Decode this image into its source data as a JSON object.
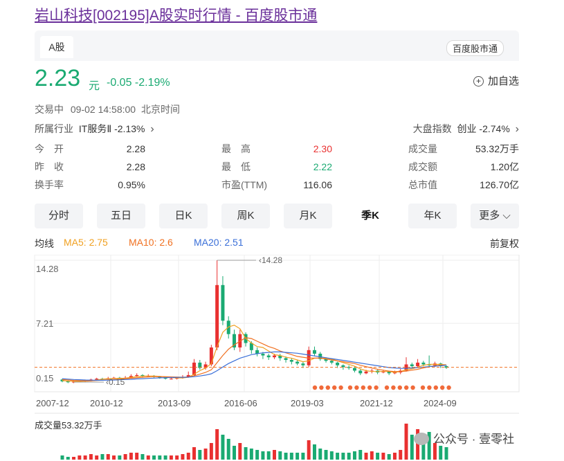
{
  "page_title": "岩山科技[002195]A股实时行情 - 百度股市通",
  "tab_label": "A股",
  "brand_badge": "百度股市通",
  "price": "2.23",
  "price_unit": "元",
  "change": "-0.05",
  "change_pct": "-2.19%",
  "add_watchlist": "加自选",
  "status_text": "交易中",
  "status_time": "09-02 14:58:00",
  "status_tz": "北京时间",
  "industry_label": "所属行业",
  "industry_value": "IT服务Ⅱ -2.13%",
  "market_label": "大盘指数",
  "market_value": "创业 -2.74%",
  "chevron": "›",
  "stats": [
    {
      "label": "今　开",
      "value": "2.28",
      "color": "#333333"
    },
    {
      "label": "最　高",
      "value": "2.30",
      "color": "#e93030"
    },
    {
      "label": "成交量",
      "value": "53.32万手",
      "color": "#333333"
    },
    {
      "label": "昨　收",
      "value": "2.28",
      "color": "#333333"
    },
    {
      "label": "最　低",
      "value": "2.22",
      "color": "#1aaa72"
    },
    {
      "label": "成交额",
      "value": "1.20亿",
      "color": "#333333"
    },
    {
      "label": "换手率",
      "value": "0.95%",
      "color": "#333333"
    },
    {
      "label": "市盈(TTM)",
      "value": "116.06",
      "color": "#333333"
    },
    {
      "label": "总市值",
      "value": "126.70亿",
      "color": "#333333"
    }
  ],
  "period_tabs": [
    {
      "label": "分时",
      "active": false
    },
    {
      "label": "五日",
      "active": false
    },
    {
      "label": "日K",
      "active": false
    },
    {
      "label": "周K",
      "active": false
    },
    {
      "label": "月K",
      "active": false
    },
    {
      "label": "季K",
      "active": true
    },
    {
      "label": "年K",
      "active": false
    },
    {
      "label": "更多",
      "active": false
    }
  ],
  "ma_label": "均线",
  "ma5": "MA5: 2.75",
  "ma10": "MA10: 2.6",
  "ma20": "MA20: 2.51",
  "adjust_label": "前复权",
  "colors": {
    "up": "#e93030",
    "down": "#1aaa72",
    "ma5": "#f0a020",
    "ma10": "#f07020",
    "ma20": "#3a6fd8",
    "accent": "#6a2f9a"
  },
  "volume_label": "成交量53.32万手",
  "watermark": "公众号 · 壹零社",
  "chart_data": {
    "type": "candlestick",
    "y_ticks": [
      "14.28",
      "7.21",
      "0.15"
    ],
    "x_ticks": [
      "2007-12",
      "2010-12",
      "2013-09",
      "2016-06",
      "2019-03",
      "2021-12",
      "2024-09"
    ],
    "max_label": "14.28",
    "min_label": "0.15",
    "ylim": [
      0.15,
      14.28
    ],
    "reference_price": 2.28,
    "candles": [
      [
        0.9,
        0.7,
        1.0,
        0.6
      ],
      [
        0.7,
        0.6,
        0.8,
        0.5
      ],
      [
        0.6,
        0.65,
        0.8,
        0.5
      ],
      [
        0.65,
        0.7,
        0.8,
        0.6
      ],
      [
        0.7,
        0.8,
        0.9,
        0.6
      ],
      [
        0.8,
        0.9,
        1.0,
        0.7
      ],
      [
        0.9,
        1.0,
        1.1,
        0.8
      ],
      [
        1.0,
        0.95,
        1.1,
        0.85
      ],
      [
        0.95,
        1.05,
        1.2,
        0.9
      ],
      [
        1.05,
        1.1,
        1.2,
        1.0
      ],
      [
        1.1,
        1.0,
        1.2,
        0.9
      ],
      [
        1.0,
        1.1,
        1.3,
        0.95
      ],
      [
        1.1,
        1.3,
        1.5,
        1.0
      ],
      [
        1.3,
        1.4,
        1.6,
        1.2
      ],
      [
        1.4,
        1.3,
        1.5,
        1.2
      ],
      [
        1.3,
        1.3,
        1.5,
        1.2
      ],
      [
        1.3,
        1.2,
        1.4,
        1.1
      ],
      [
        1.2,
        1.1,
        1.3,
        1.0
      ],
      [
        1.1,
        1.0,
        1.2,
        0.9
      ],
      [
        1.0,
        1.0,
        1.1,
        0.9
      ],
      [
        1.0,
        1.1,
        1.2,
        0.9
      ],
      [
        1.1,
        1.2,
        1.4,
        1.0
      ],
      [
        1.2,
        1.4,
        1.8,
        1.1
      ],
      [
        1.4,
        2.8,
        3.2,
        1.3
      ],
      [
        2.8,
        2.2,
        3.1,
        2.0
      ],
      [
        2.2,
        2.6,
        2.9,
        2.0
      ],
      [
        2.6,
        4.5,
        4.8,
        2.4
      ],
      [
        4.5,
        11.5,
        14.28,
        4.2
      ],
      [
        11.5,
        7.5,
        12.5,
        7.0
      ],
      [
        7.5,
        6.0,
        8.0,
        5.5
      ],
      [
        6.0,
        4.5,
        6.5,
        4.2
      ],
      [
        4.5,
        6.0,
        6.5,
        4.0
      ],
      [
        6.0,
        5.0,
        6.2,
        4.6
      ],
      [
        5.0,
        4.2,
        5.2,
        3.8
      ],
      [
        4.2,
        3.8,
        4.5,
        3.5
      ],
      [
        3.8,
        3.6,
        4.0,
        3.2
      ],
      [
        3.6,
        3.4,
        3.8,
        3.1
      ],
      [
        3.4,
        3.6,
        3.8,
        3.2
      ],
      [
        3.6,
        3.3,
        3.8,
        3.0
      ],
      [
        3.3,
        3.1,
        3.5,
        2.8
      ],
      [
        3.1,
        2.9,
        3.3,
        2.6
      ],
      [
        2.9,
        2.7,
        3.1,
        2.5
      ],
      [
        2.7,
        2.5,
        2.9,
        2.2
      ],
      [
        2.5,
        4.2,
        4.6,
        2.3
      ],
      [
        4.2,
        3.8,
        4.6,
        3.5
      ],
      [
        3.8,
        3.2,
        4.0,
        3.0
      ],
      [
        3.2,
        3.0,
        3.4,
        2.8
      ],
      [
        3.0,
        2.8,
        3.2,
        2.6
      ],
      [
        2.8,
        2.5,
        2.9,
        2.2
      ],
      [
        2.5,
        2.3,
        2.6,
        2.0
      ],
      [
        2.3,
        2.2,
        2.5,
        2.0
      ],
      [
        2.2,
        1.9,
        2.4,
        1.7
      ],
      [
        1.9,
        1.6,
        2.1,
        1.4
      ],
      [
        1.6,
        1.8,
        2.0,
        1.5
      ],
      [
        1.8,
        1.9,
        2.1,
        1.6
      ],
      [
        1.9,
        1.7,
        2.0,
        1.5
      ],
      [
        1.7,
        1.8,
        2.0,
        1.6
      ],
      [
        1.8,
        1.6,
        1.9,
        1.4
      ],
      [
        1.6,
        1.7,
        1.9,
        1.5
      ],
      [
        1.7,
        1.9,
        2.1,
        1.5
      ],
      [
        1.9,
        2.6,
        3.4,
        1.8
      ],
      [
        2.6,
        2.4,
        2.8,
        2.2
      ],
      [
        2.4,
        2.8,
        3.2,
        2.3
      ],
      [
        2.8,
        2.6,
        3.0,
        2.4
      ],
      [
        2.6,
        2.5,
        3.6,
        2.4
      ],
      [
        2.5,
        2.7,
        2.9,
        2.3
      ],
      [
        2.7,
        2.4,
        2.8,
        2.2
      ],
      [
        2.4,
        2.23,
        2.5,
        2.1
      ]
    ],
    "ma5": [
      0.8,
      0.72,
      0.7,
      0.7,
      0.72,
      0.75,
      0.85,
      0.95,
      1.0,
      1.02,
      1.04,
      1.06,
      1.15,
      1.22,
      1.28,
      1.3,
      1.3,
      1.25,
      1.2,
      1.12,
      1.08,
      1.08,
      1.16,
      1.5,
      1.9,
      2.2,
      2.7,
      4.6,
      6.2,
      6.8,
      7.0,
      6.6,
      5.5,
      5.0,
      4.6,
      4.5,
      4.1,
      3.7,
      3.6,
      3.4,
      3.3,
      3.1,
      2.9,
      3.0,
      3.3,
      3.3,
      3.3,
      3.2,
      3.0,
      2.8,
      2.6,
      2.4,
      2.1,
      1.9,
      1.8,
      1.8,
      1.8,
      1.8,
      1.7,
      1.8,
      2.0,
      2.1,
      2.3,
      2.5,
      2.6,
      2.6,
      2.6,
      2.55
    ],
    "ma10": [
      0.9,
      0.85,
      0.8,
      0.78,
      0.76,
      0.76,
      0.8,
      0.84,
      0.88,
      0.9,
      0.95,
      1.0,
      1.05,
      1.1,
      1.15,
      1.18,
      1.22,
      1.24,
      1.22,
      1.2,
      1.18,
      1.16,
      1.18,
      1.32,
      1.5,
      1.7,
      2.0,
      2.8,
      3.6,
      4.3,
      4.8,
      5.2,
      5.6,
      5.5,
      5.2,
      4.9,
      4.6,
      4.4,
      4.1,
      3.9,
      3.7,
      3.5,
      3.4,
      3.3,
      3.3,
      3.3,
      3.2,
      3.1,
      3.0,
      2.9,
      2.8,
      2.7,
      2.5,
      2.35,
      2.2,
      2.05,
      1.95,
      1.85,
      1.8,
      1.8,
      1.85,
      1.95,
      2.05,
      2.2,
      2.35,
      2.45,
      2.5,
      2.55
    ],
    "ma20": [
      1.0,
      0.95,
      0.9,
      0.88,
      0.85,
      0.83,
      0.82,
      0.82,
      0.83,
      0.85,
      0.87,
      0.9,
      0.93,
      0.97,
      1.0,
      1.03,
      1.06,
      1.09,
      1.11,
      1.13,
      1.14,
      1.15,
      1.17,
      1.22,
      1.3,
      1.4,
      1.55,
      1.9,
      2.3,
      2.7,
      3.0,
      3.3,
      3.5,
      3.7,
      3.8,
      3.9,
      3.95,
      4.0,
      4.0,
      3.95,
      3.9,
      3.85,
      3.75,
      3.65,
      3.55,
      3.45,
      3.35,
      3.25,
      3.15,
      3.05,
      2.95,
      2.85,
      2.75,
      2.65,
      2.55,
      2.45,
      2.35,
      2.25,
      2.2,
      2.15,
      2.15,
      2.2,
      2.25,
      2.3,
      2.35,
      2.4,
      2.45,
      2.51
    ],
    "marker_dots": 20,
    "volumes": [
      3,
      2,
      2,
      3,
      3,
      4,
      3,
      4,
      4,
      3,
      3,
      4,
      5,
      5,
      4,
      3,
      3,
      3,
      3,
      3,
      3,
      4,
      5,
      9,
      7,
      8,
      12,
      22,
      18,
      15,
      10,
      12,
      9,
      8,
      7,
      6,
      6,
      7,
      6,
      5,
      5,
      5,
      5,
      14,
      11,
      8,
      7,
      6,
      5,
      5,
      5,
      6,
      7,
      5,
      6,
      5,
      5,
      4,
      5,
      7,
      26,
      18,
      22,
      16,
      20,
      12,
      10,
      9
    ]
  }
}
